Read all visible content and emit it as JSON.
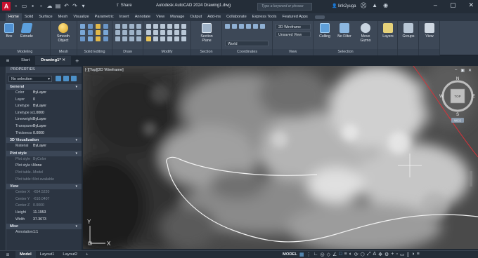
{
  "titlebar": {
    "logo": "A",
    "share_label": "Share",
    "title": "Autodesk AutoCAD 2024   Drawing1.dwg",
    "search_placeholder": "Type a keyword or phrase",
    "user": "link2yuga"
  },
  "ribbon_tabs": [
    "Home",
    "Solid",
    "Surface",
    "Mesh",
    "Visualize",
    "Parametric",
    "Insert",
    "Annotate",
    "View",
    "Manage",
    "Output",
    "Add-ins",
    "Collaborate",
    "Express Tools",
    "Featured Apps"
  ],
  "ribbon": {
    "modeling": {
      "title": "Modeling",
      "box": "Box",
      "extrude": "Extrude",
      "smooth": "Smooth Object"
    },
    "mesh": {
      "title": "Mesh"
    },
    "solid_editing": {
      "title": "Solid Editing"
    },
    "draw": {
      "title": "Draw"
    },
    "modify": {
      "title": "Modify"
    },
    "section": {
      "title": "Section",
      "section_plane": "Section Plane"
    },
    "coordinates": {
      "title": "Coordinates",
      "ucs": "World"
    },
    "view": {
      "title": "View",
      "visual_style": "2D Wireframe",
      "saved_view": "Unsaved View"
    },
    "selection": {
      "title": "Selection",
      "culling": "Culling",
      "no_filter": "No Filter",
      "move_gizmo": "Move Gizmo"
    },
    "layers": "Layers",
    "groups": "Groups",
    "view_btn": "View"
  },
  "file_tabs": {
    "start": "Start",
    "drawing": "Drawing1*"
  },
  "properties": {
    "header": "PROPERTIES",
    "selection": "No selection",
    "sections": [
      {
        "title": "General",
        "rows": [
          {
            "k": "Color",
            "v": "ByLayer"
          },
          {
            "k": "Layer",
            "v": "0"
          },
          {
            "k": "Linetype",
            "v": "ByLayer"
          },
          {
            "k": "Linetype sc...",
            "v": "1.0000"
          },
          {
            "k": "Lineweight",
            "v": "ByLayer"
          },
          {
            "k": "Transparen...",
            "v": "ByLayer"
          },
          {
            "k": "Thickness",
            "v": "0.0000"
          }
        ]
      },
      {
        "title": "3D Visualization",
        "rows": [
          {
            "k": "Material",
            "v": "ByLayer"
          }
        ]
      },
      {
        "title": "Plot style",
        "rows": [
          {
            "k": "Plot style",
            "v": "ByColor"
          },
          {
            "k": "Plot style t...",
            "v": "None"
          },
          {
            "k": "Plot table...",
            "v": "Model"
          },
          {
            "k": "Plot table t...",
            "v": "Not available"
          }
        ]
      },
      {
        "title": "View",
        "rows": [
          {
            "k": "Center X",
            "v": "-654.5220"
          },
          {
            "k": "Center Y",
            "v": "-610.0407"
          },
          {
            "k": "Center Z",
            "v": "0.0000"
          },
          {
            "k": "Height",
            "v": "11.1953"
          },
          {
            "k": "Width",
            "v": "37.3673"
          }
        ]
      },
      {
        "title": "Misc",
        "rows": [
          {
            "k": "Annotation ...",
            "v": "1:1"
          }
        ]
      }
    ]
  },
  "viewport": {
    "label": "[-][Top][2D Wireframe]",
    "viewcube": {
      "n": "N",
      "s": "S",
      "e": "E",
      "w": "W",
      "face": "TOP",
      "wcs": "WCS"
    },
    "ucs_y": "Y",
    "ucs_x": "X"
  },
  "statusbar": {
    "model_tab": "Model",
    "layout1": "Layout1",
    "layout2": "Layout2",
    "model": "MODEL"
  },
  "colors": {
    "accent": "#4c90c8",
    "autodesk_red": "#c8102e",
    "ribbon_bg": "#3d4857"
  }
}
